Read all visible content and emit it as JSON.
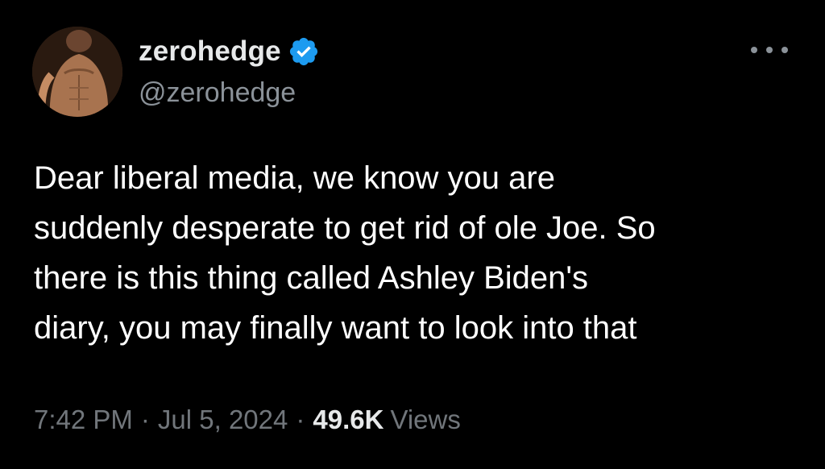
{
  "author": {
    "display_name": "zerohedge",
    "handle": "@zerohedge",
    "verified": true,
    "verified_color": "#1d9bf0"
  },
  "tweet": {
    "text": "Dear liberal media, we know you are\nsuddenly desperate to get rid of ole Joe. So\nthere is this thing called Ashley Biden's\ndiary, you may finally want to look into that"
  },
  "meta": {
    "time": "7:42 PM",
    "separator": "·",
    "date": "Jul 5, 2024",
    "views_count": "49.6K",
    "views_label": "Views"
  },
  "icons": {
    "more": "more-options-icon",
    "verified": "verified-badge-icon",
    "avatar": "avatar-image"
  },
  "colors": {
    "background": "#000000",
    "primary_text": "#e7e9ea",
    "secondary_text": "#71767b"
  }
}
